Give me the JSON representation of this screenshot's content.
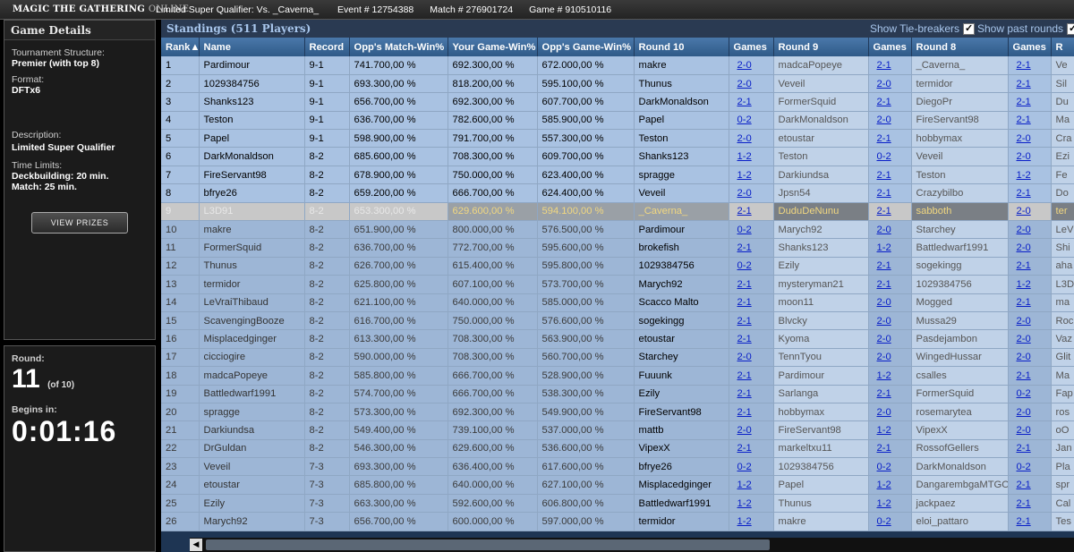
{
  "titlebar": {
    "logo_main": "MAGIC THE GATHERING",
    "logo_sub": "ONLINE",
    "event_name": "Limited Super Qualifier: Vs. _Caverna_",
    "event_id": "Event # 12754388",
    "match_id": "Match # 276901724",
    "game_id": "Game # 910510116"
  },
  "details": {
    "heading": "Game Details",
    "structure_label": "Tournament Structure:",
    "structure_value": "Premier (with top 8)",
    "format_label": "Format:",
    "format_value": "DFTx6",
    "description_label": "Description:",
    "description_value": "Limited Super Qualifier",
    "time_limits_label": "Time Limits:",
    "deckbuilding": "Deckbuilding: 20 min.",
    "match": "Match: 25 min.",
    "prizes_button": "VIEW PRIZES"
  },
  "round_panel": {
    "round_label": "Round:",
    "round_number": "11",
    "round_of": "(of 10)",
    "begins_label": "Begins in:",
    "timer": "0:01:16"
  },
  "standings": {
    "title": "Standings (511 Players)",
    "show_tiebreakers": "Show Tie-breakers",
    "show_past_rounds": "Show past rounds",
    "columns": [
      "Rank▲",
      "Name",
      "Record",
      "Opp's Match-Win%",
      "Your Game-Win%",
      "Opp's Game-Win%",
      "Round 10",
      "Games",
      "Round 9",
      "Games",
      "Round 8",
      "Games",
      "R"
    ],
    "rows": [
      [
        "1",
        "Pardimour",
        "9-1",
        "741.700,00 %",
        "692.300,00 %",
        "672.000,00 %",
        "makre",
        "2-0",
        "madcaPopeye",
        "2-1",
        "_Caverna_",
        "2-1",
        "Ve"
      ],
      [
        "2",
        "1029384756",
        "9-1",
        "693.300,00 %",
        "818.200,00 %",
        "595.100,00 %",
        "Thunus",
        "2-0",
        "Veveil",
        "2-0",
        "termidor",
        "2-1",
        "Sil"
      ],
      [
        "3",
        "Shanks123",
        "9-1",
        "656.700,00 %",
        "692.300,00 %",
        "607.700,00 %",
        "DarkMonaldson",
        "2-1",
        "FormerSquid",
        "2-1",
        "DiegoPr",
        "2-1",
        "Du"
      ],
      [
        "4",
        "Teston",
        "9-1",
        "636.700,00 %",
        "782.600,00 %",
        "585.900,00 %",
        "Papel",
        "0-2",
        "DarkMonaldson",
        "2-0",
        "FireServant98",
        "2-1",
        "Ma"
      ],
      [
        "5",
        "Papel",
        "9-1",
        "598.900,00 %",
        "791.700,00 %",
        "557.300,00 %",
        "Teston",
        "2-0",
        "etoustar",
        "2-1",
        "hobbymax",
        "2-0",
        "Cra"
      ],
      [
        "6",
        "DarkMonaldson",
        "8-2",
        "685.600,00 %",
        "708.300,00 %",
        "609.700,00 %",
        "Shanks123",
        "1-2",
        "Teston",
        "0-2",
        "Veveil",
        "2-0",
        "Ezi"
      ],
      [
        "7",
        "FireServant98",
        "8-2",
        "678.900,00 %",
        "750.000,00 %",
        "623.400,00 %",
        "spragge",
        "1-2",
        "Darkiundsa",
        "2-1",
        "Teston",
        "1-2",
        "Fe"
      ],
      [
        "8",
        "bfrye26",
        "8-2",
        "659.200,00 %",
        "666.700,00 %",
        "624.400,00 %",
        "Veveil",
        "2-0",
        "Jpsn54",
        "2-1",
        "Crazybilbo",
        "2-1",
        "Do"
      ],
      [
        "9",
        "L3D91",
        "8-2",
        "653.300,00 %",
        "629.600,00 %",
        "594.100,00 %",
        "_Caverna_",
        "2-1",
        "DuduDeNunu",
        "2-1",
        "sabboth",
        "2-0",
        "ter"
      ],
      [
        "10",
        "makre",
        "8-2",
        "651.900,00 %",
        "800.000,00 %",
        "576.500,00 %",
        "Pardimour",
        "0-2",
        "Marych92",
        "2-0",
        "Starchey",
        "2-0",
        "LeV"
      ],
      [
        "11",
        "FormerSquid",
        "8-2",
        "636.700,00 %",
        "772.700,00 %",
        "595.600,00 %",
        "brokefish",
        "2-1",
        "Shanks123",
        "1-2",
        "Battledwarf1991",
        "2-0",
        "Shi"
      ],
      [
        "12",
        "Thunus",
        "8-2",
        "626.700,00 %",
        "615.400,00 %",
        "595.800,00 %",
        "1029384756",
        "0-2",
        "Ezily",
        "2-1",
        "sogekingg",
        "2-1",
        "aha"
      ],
      [
        "13",
        "termidor",
        "8-2",
        "625.800,00 %",
        "607.100,00 %",
        "573.700,00 %",
        "Marych92",
        "2-1",
        "mysteryman21",
        "2-1",
        "1029384756",
        "1-2",
        "L3D"
      ],
      [
        "14",
        "LeVraiThibaud",
        "8-2",
        "621.100,00 %",
        "640.000,00 %",
        "585.000,00 %",
        "Scacco Malto",
        "2-1",
        "moon11",
        "2-0",
        "Mogged",
        "2-1",
        "ma"
      ],
      [
        "15",
        "ScavengingBooze",
        "8-2",
        "616.700,00 %",
        "750.000,00 %",
        "576.600,00 %",
        "sogekingg",
        "2-1",
        "Blvcky",
        "2-0",
        "Mussa29",
        "2-0",
        "Roc"
      ],
      [
        "16",
        "Misplacedginger",
        "8-2",
        "613.300,00 %",
        "708.300,00 %",
        "563.900,00 %",
        "etoustar",
        "2-1",
        "Kyoma",
        "2-0",
        "Pasdejambon",
        "2-0",
        "Vaz"
      ],
      [
        "17",
        "cicciogire",
        "8-2",
        "590.000,00 %",
        "708.300,00 %",
        "560.700,00 %",
        "Starchey",
        "2-0",
        "TennTyou",
        "2-0",
        "WingedHussar",
        "2-0",
        "Glit"
      ],
      [
        "18",
        "madcaPopeye",
        "8-2",
        "585.800,00 %",
        "666.700,00 %",
        "528.900,00 %",
        "Fuuunk",
        "2-1",
        "Pardimour",
        "1-2",
        "csalles",
        "2-1",
        "Ma"
      ],
      [
        "19",
        "Battledwarf1991",
        "8-2",
        "574.700,00 %",
        "666.700,00 %",
        "538.300,00 %",
        "Ezily",
        "2-1",
        "Sarlanga",
        "2-1",
        "FormerSquid",
        "0-2",
        "Fap"
      ],
      [
        "20",
        "spragge",
        "8-2",
        "573.300,00 %",
        "692.300,00 %",
        "549.900,00 %",
        "FireServant98",
        "2-1",
        "hobbymax",
        "2-0",
        "rosemarytea",
        "2-0",
        "ros"
      ],
      [
        "21",
        "Darkiundsa",
        "8-2",
        "549.400,00 %",
        "739.100,00 %",
        "537.000,00 %",
        "mattb",
        "2-0",
        "FireServant98",
        "1-2",
        "VipexX",
        "2-0",
        "oO"
      ],
      [
        "22",
        "DrGuldan",
        "8-2",
        "546.300,00 %",
        "629.600,00 %",
        "536.600,00 %",
        "VipexX",
        "2-1",
        "markeltxu11",
        "2-1",
        "RossofGellers",
        "2-1",
        "Jan"
      ],
      [
        "23",
        "Veveil",
        "7-3",
        "693.300,00 %",
        "636.400,00 %",
        "617.600,00 %",
        "bfrye26",
        "0-2",
        "1029384756",
        "0-2",
        "DarkMonaldson",
        "0-2",
        "Pla"
      ],
      [
        "24",
        "etoustar",
        "7-3",
        "685.800,00 %",
        "640.000,00 %",
        "627.100,00 %",
        "Misplacedginger",
        "1-2",
        "Papel",
        "1-2",
        "DangarembgaMTGO",
        "2-1",
        "spr"
      ],
      [
        "25",
        "Ezily",
        "7-3",
        "663.300,00 %",
        "592.600,00 %",
        "606.800,00 %",
        "Battledwarf1991",
        "1-2",
        "Thunus",
        "1-2",
        "jackpaez",
        "2-1",
        "Cal"
      ],
      [
        "26",
        "Marych92",
        "7-3",
        "656.700,00 %",
        "600.000,00 %",
        "597.000,00 %",
        "termidor",
        "1-2",
        "makre",
        "0-2",
        "eloi_pattaro",
        "2-1",
        "Tes"
      ]
    ]
  },
  "colors": {
    "title_blue": "#a8c6ec",
    "header_blue": "#3f6c9e",
    "top8_row": "#a9c2e2",
    "highlight_gold": "#f1d780",
    "link_blue": "#0a20c8"
  }
}
